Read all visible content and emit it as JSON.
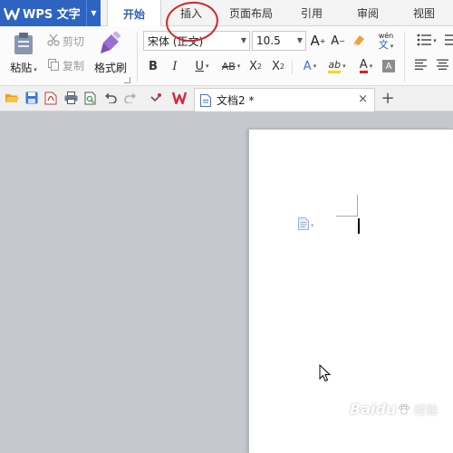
{
  "app": {
    "name": "WPS 文字"
  },
  "tabs": [
    {
      "label": "开始",
      "active": true
    },
    {
      "label": "插入",
      "annotated": true
    },
    {
      "label": "页面布局"
    },
    {
      "label": "引用"
    },
    {
      "label": "审阅"
    },
    {
      "label": "视图"
    }
  ],
  "ribbon": {
    "paste_label": "粘贴",
    "cut_label": "剪切",
    "copy_label": "复制",
    "format_painter_label": "格式刷",
    "font_name": "宋体 (正文)",
    "font_size": "10.5",
    "grow_font": "A",
    "shrink_font": "A",
    "phonetic": "wén",
    "bold": "B",
    "italic": "I",
    "underline": "U",
    "strike": "AB",
    "superscript": "X",
    "subscript": "X",
    "text_effect": "A",
    "highlight": "ab",
    "font_color": "A",
    "char_shading": "A"
  },
  "document": {
    "tab_name": "文档2 *",
    "close": "×",
    "new_tab": "+"
  },
  "watermark": {
    "text": "Baidu",
    "sub": "经验"
  },
  "colors": {
    "accent": "#2d63c1",
    "annotation": "#d6242b",
    "workspace": "#c5c8cf",
    "highlight": "#f5d600",
    "font_color": "#e02020"
  }
}
